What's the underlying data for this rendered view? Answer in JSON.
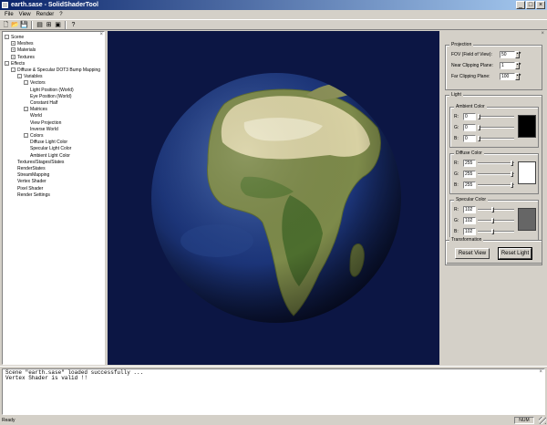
{
  "window": {
    "title": "earth.sase - SolidShaderTool",
    "buttons": [
      "_",
      "□",
      "×"
    ]
  },
  "menu": [
    "File",
    "View",
    "Render",
    "?"
  ],
  "toolbar": {
    "buttons": [
      {
        "icon": "new-icon",
        "glyph": "🗋"
      },
      {
        "icon": "open-icon",
        "glyph": "📂"
      },
      {
        "icon": "save-icon",
        "glyph": "💾"
      },
      {
        "icon": "properties-icon",
        "glyph": "▤"
      },
      {
        "icon": "shader-tree-icon",
        "glyph": "⊞"
      },
      {
        "icon": "render-icon",
        "glyph": "▣"
      },
      {
        "icon": "help-icon",
        "glyph": "?"
      }
    ]
  },
  "scene_tree": {
    "items": [
      {
        "label": "Scene",
        "depth": 0,
        "expander": "-"
      },
      {
        "label": "Meshes",
        "depth": 1,
        "expander": "+"
      },
      {
        "label": "Materials",
        "depth": 1,
        "expander": "+"
      },
      {
        "label": "Textures",
        "depth": 1,
        "expander": "+"
      },
      {
        "label": "Effects",
        "depth": 0,
        "expander": "-"
      },
      {
        "label": "Diffuse & Specular DOT3 Bump Mapping",
        "depth": 1,
        "expander": "-"
      },
      {
        "label": "Variables",
        "depth": 2,
        "expander": "-"
      },
      {
        "label": "Vectors",
        "depth": 3,
        "expander": "-"
      },
      {
        "label": "Light Position (World)",
        "depth": 4,
        "expander": ""
      },
      {
        "label": "Eye Position (World)",
        "depth": 4,
        "expander": ""
      },
      {
        "label": "Constant Half",
        "depth": 4,
        "expander": ""
      },
      {
        "label": "Matrices",
        "depth": 3,
        "expander": "-"
      },
      {
        "label": "World",
        "depth": 4,
        "expander": ""
      },
      {
        "label": "View Projection",
        "depth": 4,
        "expander": ""
      },
      {
        "label": "Inverse World",
        "depth": 4,
        "expander": ""
      },
      {
        "label": "Colors",
        "depth": 3,
        "expander": "-"
      },
      {
        "label": "Diffuse Light Color",
        "depth": 4,
        "expander": ""
      },
      {
        "label": "Specular Light Color",
        "depth": 4,
        "expander": ""
      },
      {
        "label": "Ambient Light Color",
        "depth": 4,
        "expander": ""
      },
      {
        "label": "Textures/Stages/States",
        "depth": 2,
        "expander": ""
      },
      {
        "label": "RenderStates",
        "depth": 2,
        "expander": ""
      },
      {
        "label": "StreamMapping",
        "depth": 2,
        "expander": ""
      },
      {
        "label": "Vertex Shader",
        "depth": 2,
        "expander": ""
      },
      {
        "label": "Pixel Shader",
        "depth": 2,
        "expander": ""
      },
      {
        "label": "Render Settings",
        "depth": 2,
        "expander": ""
      }
    ]
  },
  "projection": {
    "title": "Projection",
    "fov_label": "FOV (Field of View):",
    "fov_value": "50",
    "near_label": "Near Clipping Plane:",
    "near_value": "1",
    "far_label": "Far Clipping Plane:",
    "far_value": "100"
  },
  "light": {
    "title": "Light",
    "ambient": {
      "title": "Ambient Color",
      "r": "0",
      "g": "0",
      "b": "0",
      "swatch": "#000000"
    },
    "diffuse": {
      "title": "Diffuse Color",
      "r": "255",
      "g": "255",
      "b": "255",
      "swatch": "#ffffff"
    },
    "specular": {
      "title": "Specular Color",
      "r": "102",
      "g": "102",
      "b": "102",
      "swatch": "#666666"
    },
    "labels": {
      "r": "R:",
      "g": "G:",
      "b": "B:"
    }
  },
  "transformation": {
    "title": "Transformation",
    "reset_view": "Reset View",
    "reset_light": "Reset Light"
  },
  "output": {
    "lines": [
      "Scene \"earth.sase\" loaded successfully ...",
      "Vertex Shader is valid !!"
    ]
  },
  "status": {
    "text": "Ready",
    "num": "NUM"
  },
  "colors": {
    "title_start": "#0a246a",
    "title_end": "#a6caf0",
    "viewport_bg": "#0c1644",
    "chrome": "#d4d0c8"
  }
}
